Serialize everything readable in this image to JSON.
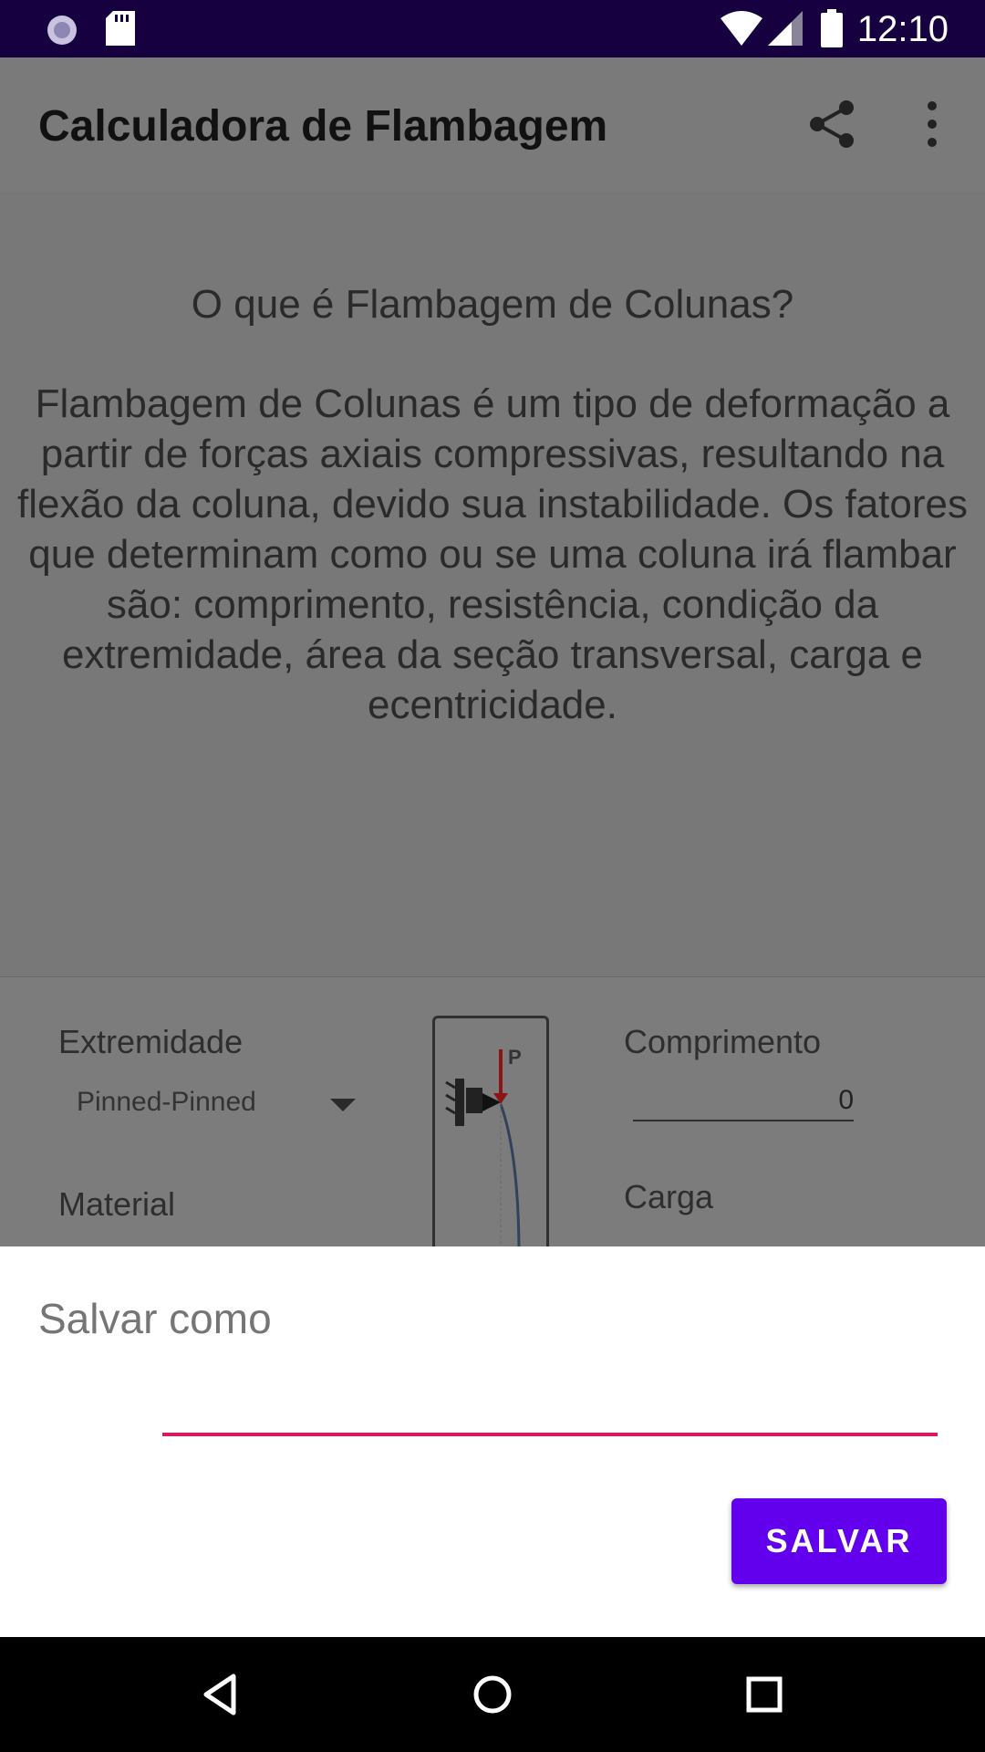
{
  "status_bar": {
    "time": "12:10",
    "icons": [
      "sync-icon",
      "sd-card-icon",
      "wifi-icon",
      "signal-icon",
      "battery-icon"
    ]
  },
  "app_bar": {
    "title": "Calculadora de Flambagem",
    "actions": [
      "share-icon",
      "more-vert-icon"
    ]
  },
  "info": {
    "title": "O que é Flambagem de Colunas?",
    "body": "Flambagem de Colunas é um tipo de deformação a partir de forças axiais compressivas, resultando na flexão da coluna, devido sua instabilidade. Os fatores que determinam como ou se uma coluna irá flambar são: comprimento, resistência, condição da extremidade, área da seção transversal, carga e ecentricidade."
  },
  "form": {
    "end_label": "Extremidade",
    "end_value": "Pinned-Pinned",
    "material_label": "Material",
    "length_label": "Comprimento",
    "length_value": "0",
    "load_label": "Carga",
    "diagram_load_label": "P"
  },
  "dialog": {
    "title": "Salvar como",
    "input_value": "",
    "save_label": "SALVAR"
  },
  "colors": {
    "status_bar": "#16003f",
    "accent": "#6200ee",
    "input_underline": "#d81b60",
    "scrim_content": "#787878"
  },
  "nav_bar": [
    "back-icon",
    "home-icon",
    "recents-icon"
  ]
}
